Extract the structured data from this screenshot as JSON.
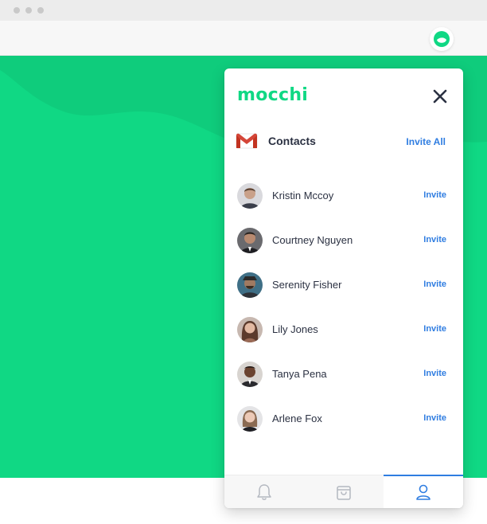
{
  "app": {
    "logo_text": "mocchi",
    "brand_color": "#10d884",
    "link_color": "#2f7de1"
  },
  "browser": {
    "extension_icon": "mocchi-extension-icon"
  },
  "contacts": {
    "source_icon": "gmail-icon",
    "title": "Contacts",
    "invite_all_label": "Invite All",
    "items": [
      {
        "name": "Kristin Mccoy",
        "invite_label": "Invite",
        "avatar": "avatar-photo"
      },
      {
        "name": "Courtney Nguyen",
        "invite_label": "Invite",
        "avatar": "avatar-photo"
      },
      {
        "name": "Serenity Fisher",
        "invite_label": "Invite",
        "avatar": "avatar-photo"
      },
      {
        "name": "Lily Jones",
        "invite_label": "Invite",
        "avatar": "avatar-photo"
      },
      {
        "name": "Tanya Pena",
        "invite_label": "Invite",
        "avatar": "avatar-photo"
      },
      {
        "name": "Arlene Fox",
        "invite_label": "Invite",
        "avatar": "avatar-photo"
      }
    ]
  },
  "bottom_nav": {
    "tabs": [
      {
        "icon": "bell-icon",
        "active": false
      },
      {
        "icon": "bag-icon",
        "active": false
      },
      {
        "icon": "user-icon",
        "active": true
      }
    ]
  }
}
